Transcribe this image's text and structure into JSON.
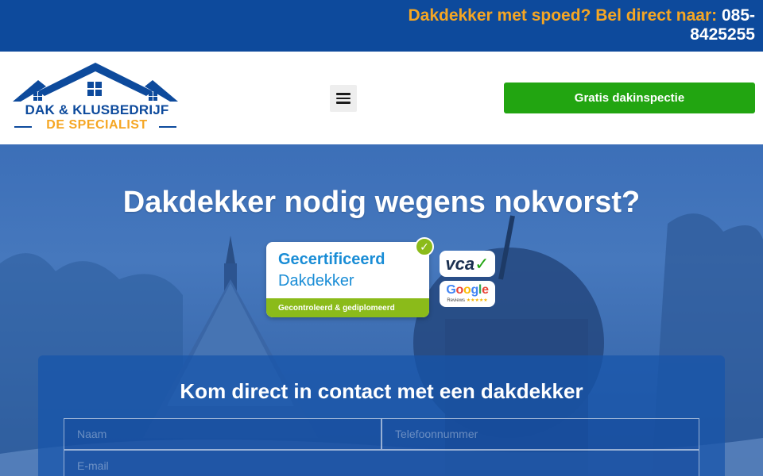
{
  "topbar": {
    "lead": "Dakdekker met spoed? Bel direct naar:",
    "phone": "085-8425255"
  },
  "logo": {
    "line1": "DAK & KLUSBEDRIJF",
    "line2": "DE SPECIALIST"
  },
  "header": {
    "menu_icon": "hamburger-icon",
    "cta_label": "Gratis dakinspectie"
  },
  "hero": {
    "title": "Dakdekker nodig wegens nokvorst?"
  },
  "badges": {
    "certified_line1": "Gecertificeerd",
    "certified_line2": "Dakdekker",
    "certified_footer": "Gecontroleerd & gediplomeerd",
    "vca_label": "vca",
    "google_label": "Google",
    "google_sub": "Reviews",
    "google_stars": "★★★★★"
  },
  "form": {
    "title": "Kom direct in contact met een dakdekker",
    "name_placeholder": "Naam",
    "phone_placeholder": "Telefoonnummer",
    "email_placeholder": "E-mail"
  },
  "colors": {
    "brand_blue": "#0d4a9c",
    "accent_orange": "#f5a623",
    "cta_green": "#22a511",
    "badge_green": "#8bbb1a"
  }
}
